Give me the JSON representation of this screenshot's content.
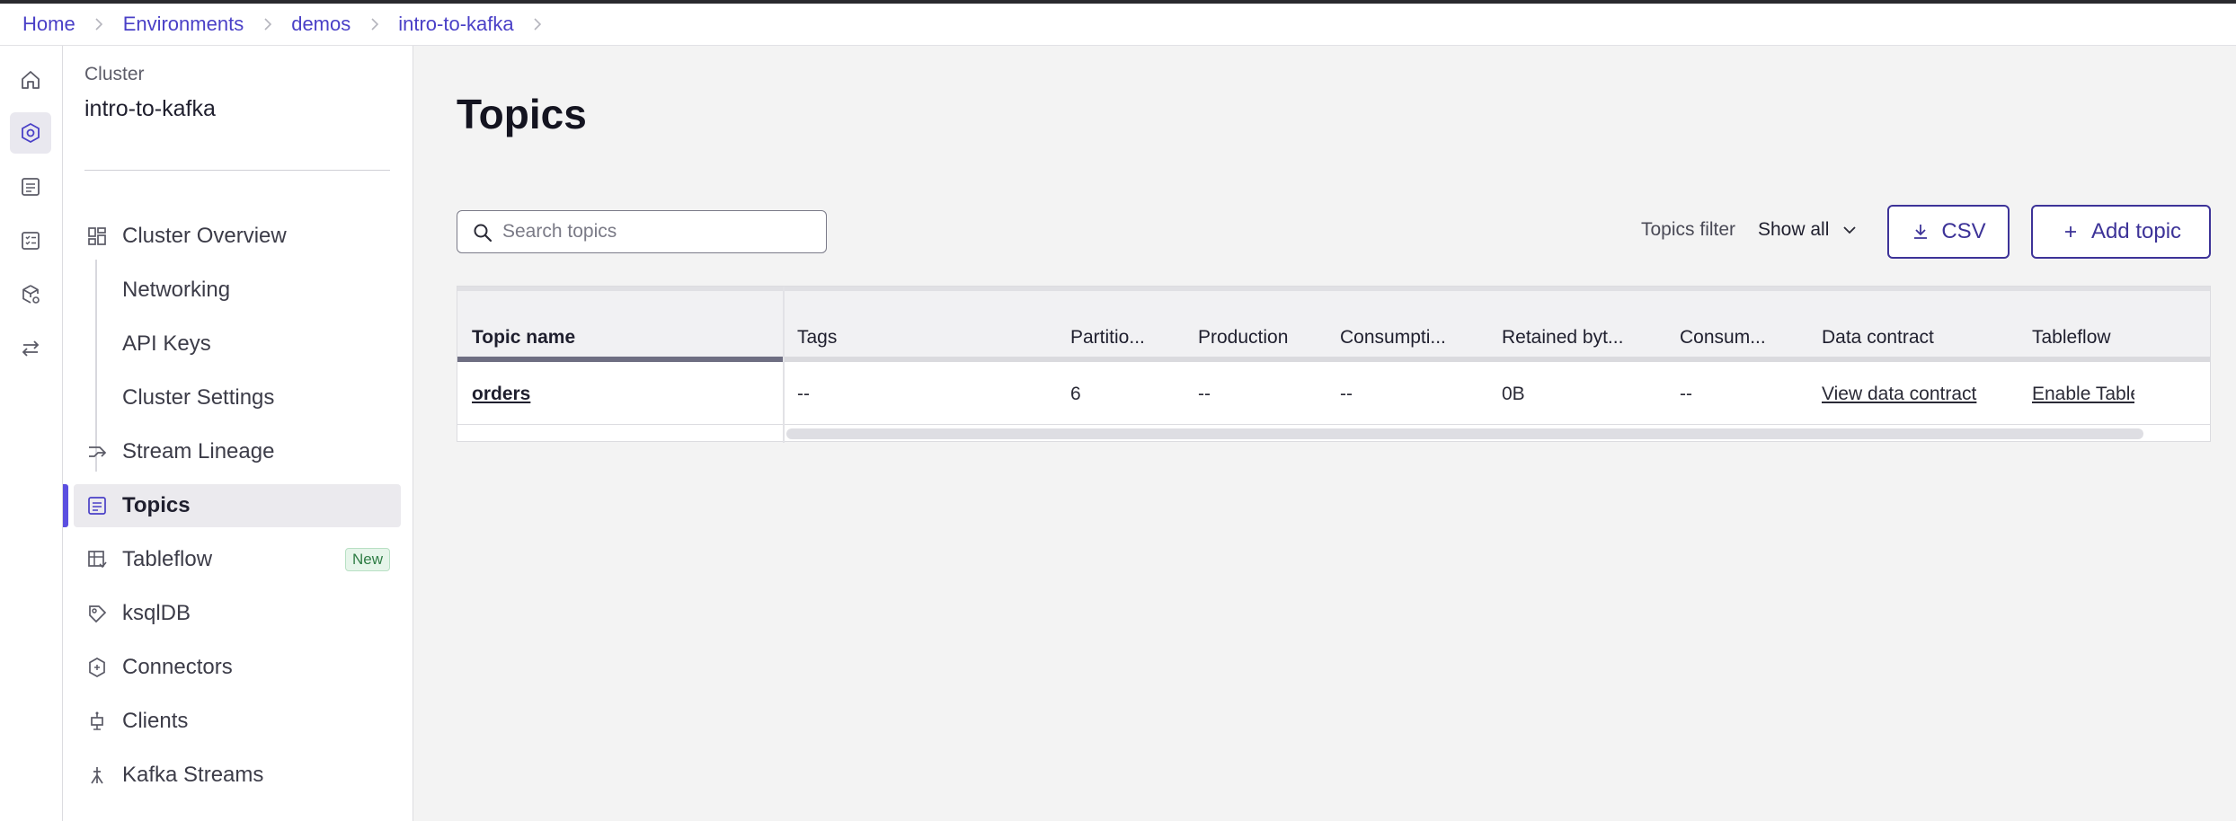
{
  "breadcrumb": [
    "Home",
    "Environments",
    "demos",
    "intro-to-kafka"
  ],
  "rail": {
    "icons": [
      "home-icon",
      "cluster-icon",
      "topics-icon",
      "checklist-icon",
      "box-settings-icon",
      "swap-icon"
    ]
  },
  "sidebar": {
    "cluster_label": "Cluster",
    "cluster_name": "intro-to-kafka",
    "items": [
      {
        "label": "Cluster Overview",
        "icon": "dashboard-icon"
      },
      {
        "label": "Networking"
      },
      {
        "label": "API Keys"
      },
      {
        "label": "Cluster Settings"
      },
      {
        "label": "Stream Lineage",
        "icon": "lineage-icon"
      },
      {
        "label": "Topics",
        "icon": "topics-icon",
        "active": true
      },
      {
        "label": "Tableflow",
        "icon": "tableflow-icon",
        "badge": "New"
      },
      {
        "label": "ksqlDB",
        "icon": "ksqldb-icon"
      },
      {
        "label": "Connectors",
        "icon": "connectors-icon"
      },
      {
        "label": "Clients",
        "icon": "clients-icon"
      },
      {
        "label": "Kafka Streams",
        "icon": "kafka-streams-icon"
      }
    ]
  },
  "main": {
    "title": "Topics",
    "search": {
      "placeholder": "Search topics",
      "value": ""
    },
    "filter": {
      "label": "Topics filter",
      "value": "Show all"
    },
    "csv_label": "CSV",
    "add_label": "Add topic",
    "table": {
      "columns": [
        "Topic name",
        "Tags",
        "Partitio...",
        "Production",
        "Consumpti...",
        "Retained byt...",
        "Consum...",
        "Data contract",
        "Tableflow"
      ],
      "rows": [
        {
          "topic": "orders",
          "tags": "--",
          "partitions": "6",
          "production": "--",
          "consumption": "--",
          "retained": "0B",
          "consumers": "--",
          "data_contract": "View data contract",
          "tableflow": "Enable Tableflow"
        }
      ]
    }
  },
  "colors": {
    "accent": "#4a40c7",
    "button_border": "#3d3398",
    "active_bar": "#5b4fe0",
    "badge_bg": "#e6f5ea",
    "badge_text": "#2f7d45"
  }
}
